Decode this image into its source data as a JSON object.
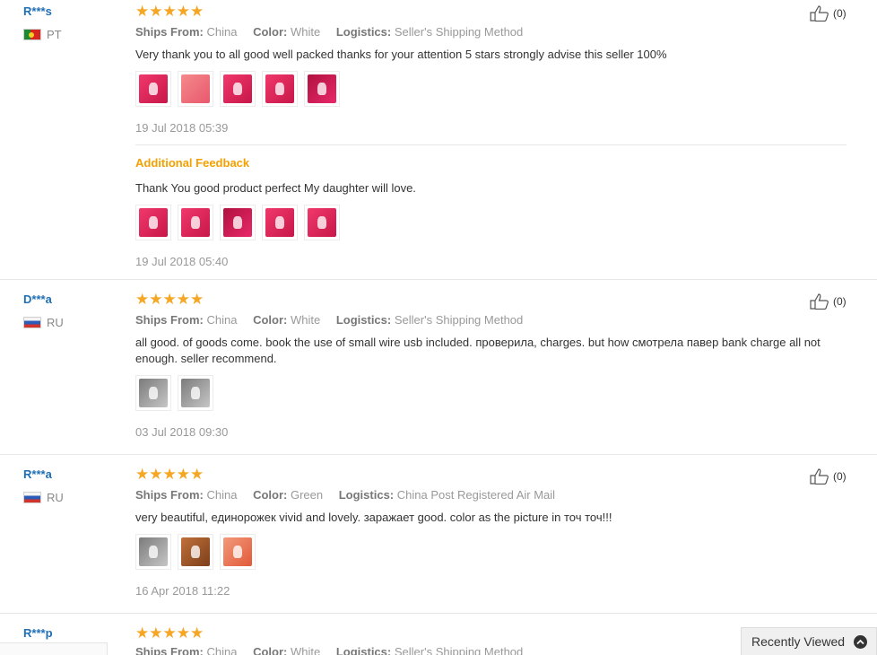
{
  "reviews": [
    {
      "user": "R***s",
      "country": "PT",
      "stars": "★★★★★",
      "ships_label": "Ships From:",
      "ships": "China",
      "color_label": "Color:",
      "color": "White",
      "logistics_label": "Logistics:",
      "logistics": "Seller's Shipping Method",
      "text": "Very thank you to all good well packed thanks for your attention 5 stars strongly advise this seller 100%",
      "date": "19 Jul 2018 05:39",
      "helpful": "(0)",
      "additional_label": "Additional Feedback",
      "additional_text": "Thank You good product perfect My daughter will love.",
      "additional_date": "19 Jul 2018 05:40"
    },
    {
      "user": "D***a",
      "country": "RU",
      "stars": "★★★★★",
      "ships_label": "Ships From:",
      "ships": "China",
      "color_label": "Color:",
      "color": "White",
      "logistics_label": "Logistics:",
      "logistics": "Seller's Shipping Method",
      "text": "all good. of goods come. book the use of small wire usb included. проверила, charges. but how смотрела павер bank charge all not enough. seller recommend.",
      "date": "03 Jul 2018 09:30",
      "helpful": "(0)"
    },
    {
      "user": "R***a",
      "country": "RU",
      "stars": "★★★★★",
      "ships_label": "Ships From:",
      "ships": "China",
      "color_label": "Color:",
      "color": "Green",
      "logistics_label": "Logistics:",
      "logistics": "China Post Registered Air Mail",
      "text": "very beautiful, единорожек vivid and lovely. заражает good. color as the picture in точ точ!!!",
      "date": "16 Apr 2018 11:22",
      "helpful": "(0)"
    },
    {
      "user": "R***p",
      "stars": "★★★★★",
      "ships_label": "Ships From:",
      "ships": "China",
      "color_label": "Color:",
      "color": "White",
      "logistics_label": "Logistics:",
      "logistics": "Seller's Shipping Method"
    }
  ],
  "recently_viewed": "Recently Viewed"
}
